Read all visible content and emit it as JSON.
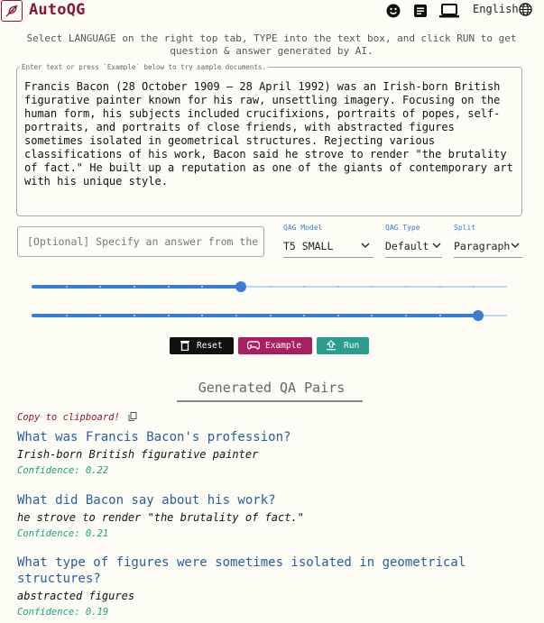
{
  "app": {
    "brand": "AutoQG",
    "language": "English"
  },
  "icons": {
    "logo": "feather-logo-icon",
    "smiley": "smiley-icon",
    "document": "document-icon",
    "laptop": "laptop-icon",
    "globe": "globe-icon"
  },
  "instructions": "Select LANGUAGE on the right top tab, TYPE into the text box, and click RUN to get question & answer generated by AI.",
  "textbox": {
    "legend": "Enter text or press `Example` below to try sample documents.",
    "content": "Francis Bacon (28 October 1909 – 28 April 1992) was an Irish-born British figurative painter known for his raw, unsettling imagery. Focusing on the human form, his subjects included crucifixions, portraits of popes, self-portraits, and portraits of close friends, with abstracted figures sometimes isolated in geometrical structures. Rejecting various classifications of his work, Bacon said he strove to render \"the brutality of fact.\" He built up a reputation as one of the giants of contemporary art with his unique style."
  },
  "answer_input": {
    "placeholder": "[Optional] Specify an answer from the …"
  },
  "selects": {
    "model": {
      "label": "QAG Model",
      "value": "T5 SMALL"
    },
    "type": {
      "label": "QAG Type",
      "value": "Default"
    },
    "split": {
      "label": "Split",
      "value": "Paragraph"
    }
  },
  "sliders": [
    {
      "level": 0.44
    },
    {
      "level": 0.94
    }
  ],
  "buttons": {
    "reset": "Reset",
    "example": "Example",
    "run": "Run"
  },
  "colors": {
    "brand": "#8a1538",
    "accent": "#3a7bd5",
    "reset_bg": "#111111",
    "example_bg": "#a8205f",
    "run_bg": "#2a9d8f",
    "confidence": "#1b9e8a",
    "question": "#2a5d9f"
  },
  "results": {
    "title": "Generated QA Pairs",
    "copy_label": "Copy to clipboard!",
    "pairs": [
      {
        "question": "What was Francis Bacon's profession?",
        "answer": "Irish-born British figurative painter",
        "confidence": "Confidence: 0.22"
      },
      {
        "question": "What did Bacon say about his work?",
        "answer": "he strove to render \"the brutality of fact.\"",
        "confidence": "Confidence: 0.21"
      },
      {
        "question": "What type of figures were sometimes isolated in geometrical structures?",
        "answer": "abstracted figures",
        "confidence": "Confidence: 0.19"
      }
    ]
  }
}
